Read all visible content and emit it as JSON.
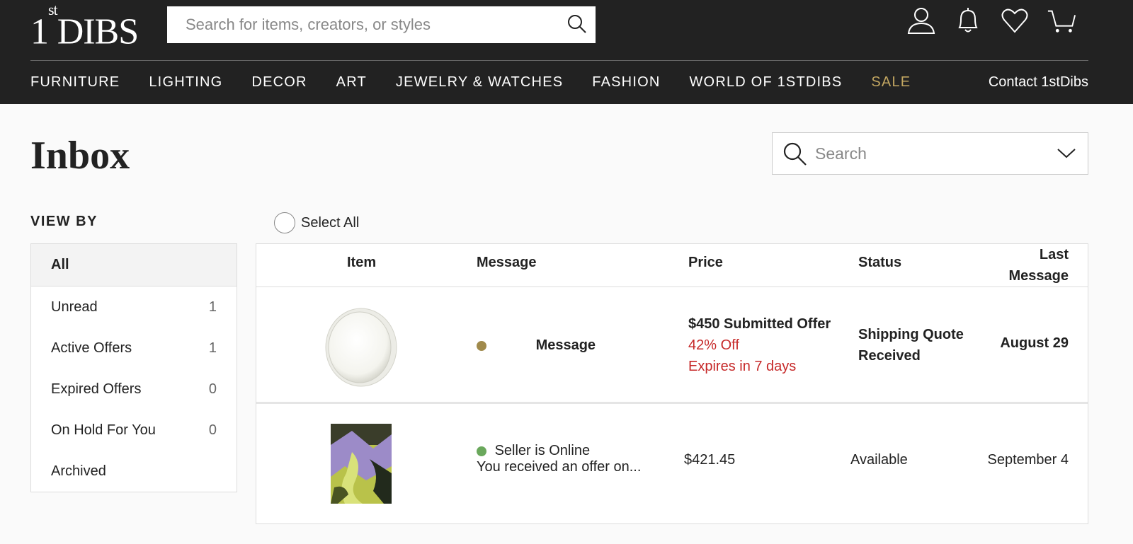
{
  "header": {
    "logo": "1stDIBS",
    "logo_prefix": "1",
    "logo_sup": "st",
    "logo_main": "DIBS",
    "search_placeholder": "Search for items, creators, or styles",
    "nav": [
      "FURNITURE",
      "LIGHTING",
      "DECOR",
      "ART",
      "JEWELRY & WATCHES",
      "FASHION",
      "WORLD OF 1STDIBS",
      "SALE"
    ],
    "contact": "Contact 1stDibs",
    "icons": [
      "user-icon",
      "bell-icon",
      "heart-icon",
      "cart-icon"
    ],
    "sale_color": "#c2a661"
  },
  "page": {
    "title": "Inbox",
    "search_placeholder": "Search"
  },
  "sidebar": {
    "heading": "VIEW BY",
    "items": [
      {
        "label": "All",
        "count": ""
      },
      {
        "label": "Unread",
        "count": "1"
      },
      {
        "label": "Active Offers",
        "count": "1"
      },
      {
        "label": "Expired Offers",
        "count": "0"
      },
      {
        "label": "On Hold For You",
        "count": "0"
      },
      {
        "label": "Archived",
        "count": ""
      }
    ]
  },
  "select_all": "Select All",
  "table": {
    "headers": {
      "item": "Item",
      "message": "Message",
      "price": "Price",
      "status": "Status",
      "last_line1": "Last",
      "last_line2": "Message"
    },
    "rows": [
      {
        "message": "Message",
        "dot_color": "#a08a4b",
        "price_main": "$450 Submitted Offer",
        "price_off": "42% Off",
        "price_expires": "Expires in 7 days",
        "status_line1": "Shipping Quote",
        "status_line2": "Received",
        "last": "August 29"
      },
      {
        "online": "Seller is Online",
        "dot_color": "#6aa85c",
        "message": "You received an offer on...",
        "price": "$421.45",
        "status": "Available",
        "last": "September 4"
      }
    ]
  }
}
